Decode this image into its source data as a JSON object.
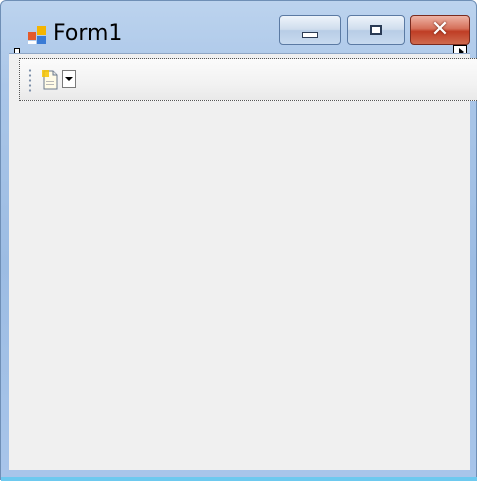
{
  "window": {
    "title": "Form1",
    "icon": "form-app-icon",
    "controls": {
      "minimize": "minimize-icon",
      "maximize": "maximize-icon",
      "close": "close-icon",
      "close_glyph": "✕"
    }
  },
  "toolstrip": {
    "button_icon": "new-document-icon",
    "dropdown_icon": "chevron-down-icon",
    "grip_icon": "grip-icon"
  },
  "designer": {
    "selection_handle": "selection-handle",
    "smart_tag_icon": "smart-tag-icon"
  },
  "colors": {
    "close_button": "#c8472d",
    "client_background": "#f0f0f0",
    "frame": "#a9c5e9",
    "accent": "#6dc9ef"
  }
}
